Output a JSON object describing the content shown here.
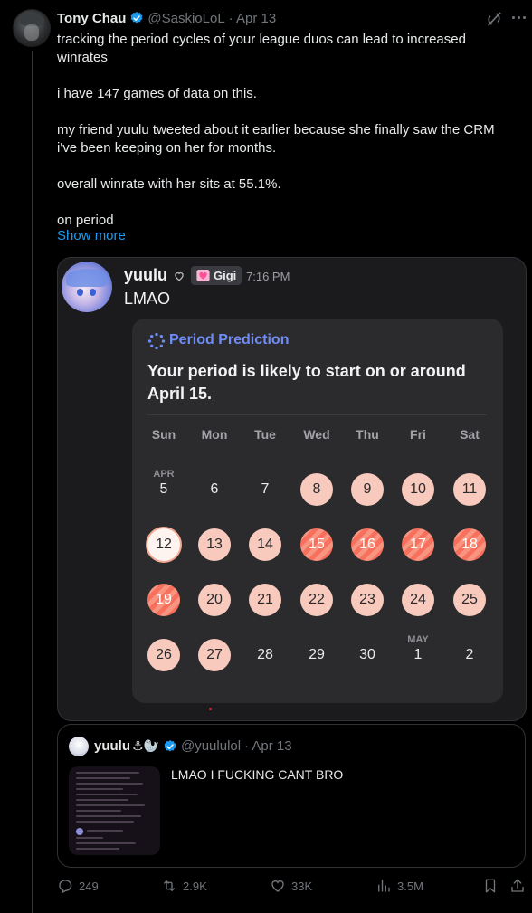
{
  "tweet": {
    "author_name": "Tony Chau",
    "handle": "@SaskioLoL",
    "date": "· Apr 13",
    "body": [
      "tracking the period cycles of your league duos can lead to increased winrates",
      "i have 147 games of data on this.",
      "my friend yuulu tweeted about it earlier because she finally saw the CRM i've been keeping on her for months.",
      "overall winrate with her sits at 55.1%.",
      "on period"
    ],
    "show_more": "Show more"
  },
  "discord": {
    "name": "yuulu",
    "badge": "Gigi",
    "time": "7:16 PM",
    "message": "LMAO"
  },
  "period_card": {
    "title": "Period Prediction",
    "headline": "Your period is likely to start on or around April 15.",
    "weekdays": [
      "Sun",
      "Mon",
      "Tue",
      "Wed",
      "Thu",
      "Fri",
      "Sat"
    ],
    "month_apr": "APR",
    "month_may": "MAY",
    "weeks": [
      [
        {
          "d": "5",
          "s": "none"
        },
        {
          "d": "6",
          "s": "none"
        },
        {
          "d": "7",
          "s": "none"
        },
        {
          "d": "8",
          "s": "light"
        },
        {
          "d": "9",
          "s": "light"
        },
        {
          "d": "10",
          "s": "light"
        },
        {
          "d": "11",
          "s": "light"
        }
      ],
      [
        {
          "d": "12",
          "s": "selected"
        },
        {
          "d": "13",
          "s": "light"
        },
        {
          "d": "14",
          "s": "light"
        },
        {
          "d": "15",
          "s": "striped"
        },
        {
          "d": "16",
          "s": "striped"
        },
        {
          "d": "17",
          "s": "striped"
        },
        {
          "d": "18",
          "s": "striped"
        }
      ],
      [
        {
          "d": "19",
          "s": "striped"
        },
        {
          "d": "20",
          "s": "light"
        },
        {
          "d": "21",
          "s": "light"
        },
        {
          "d": "22",
          "s": "light"
        },
        {
          "d": "23",
          "s": "light"
        },
        {
          "d": "24",
          "s": "light"
        },
        {
          "d": "25",
          "s": "light"
        }
      ],
      [
        {
          "d": "26",
          "s": "light"
        },
        {
          "d": "27",
          "s": "light"
        },
        {
          "d": "28",
          "s": "none"
        },
        {
          "d": "29",
          "s": "none"
        },
        {
          "d": "30",
          "s": "none"
        },
        {
          "d": "1",
          "s": "none"
        },
        {
          "d": "2",
          "s": "none"
        }
      ]
    ]
  },
  "quote": {
    "name": "yuulu",
    "emoji": "⚓🦭",
    "handle": "@yuululol",
    "date": "· Apr 13",
    "text": "LMAO I FUCKING CANT BRO"
  },
  "actions": {
    "replies": "249",
    "reposts": "2.9K",
    "likes": "33K",
    "views": "3.5M"
  },
  "colors": {
    "link": "#1d9bf0",
    "verified": "#1d9bf0",
    "period_light": "#f7cabd",
    "period_striped": "#f6705d",
    "accent_purple": "#6f8cf7"
  },
  "icons": [
    "grok-icon",
    "more-icon",
    "verified-icon",
    "heart-outline-icon",
    "heart-badge-icon",
    "spinner-icon",
    "reply-icon",
    "repost-icon",
    "like-icon",
    "views-icon",
    "bookmark-icon",
    "share-icon"
  ]
}
